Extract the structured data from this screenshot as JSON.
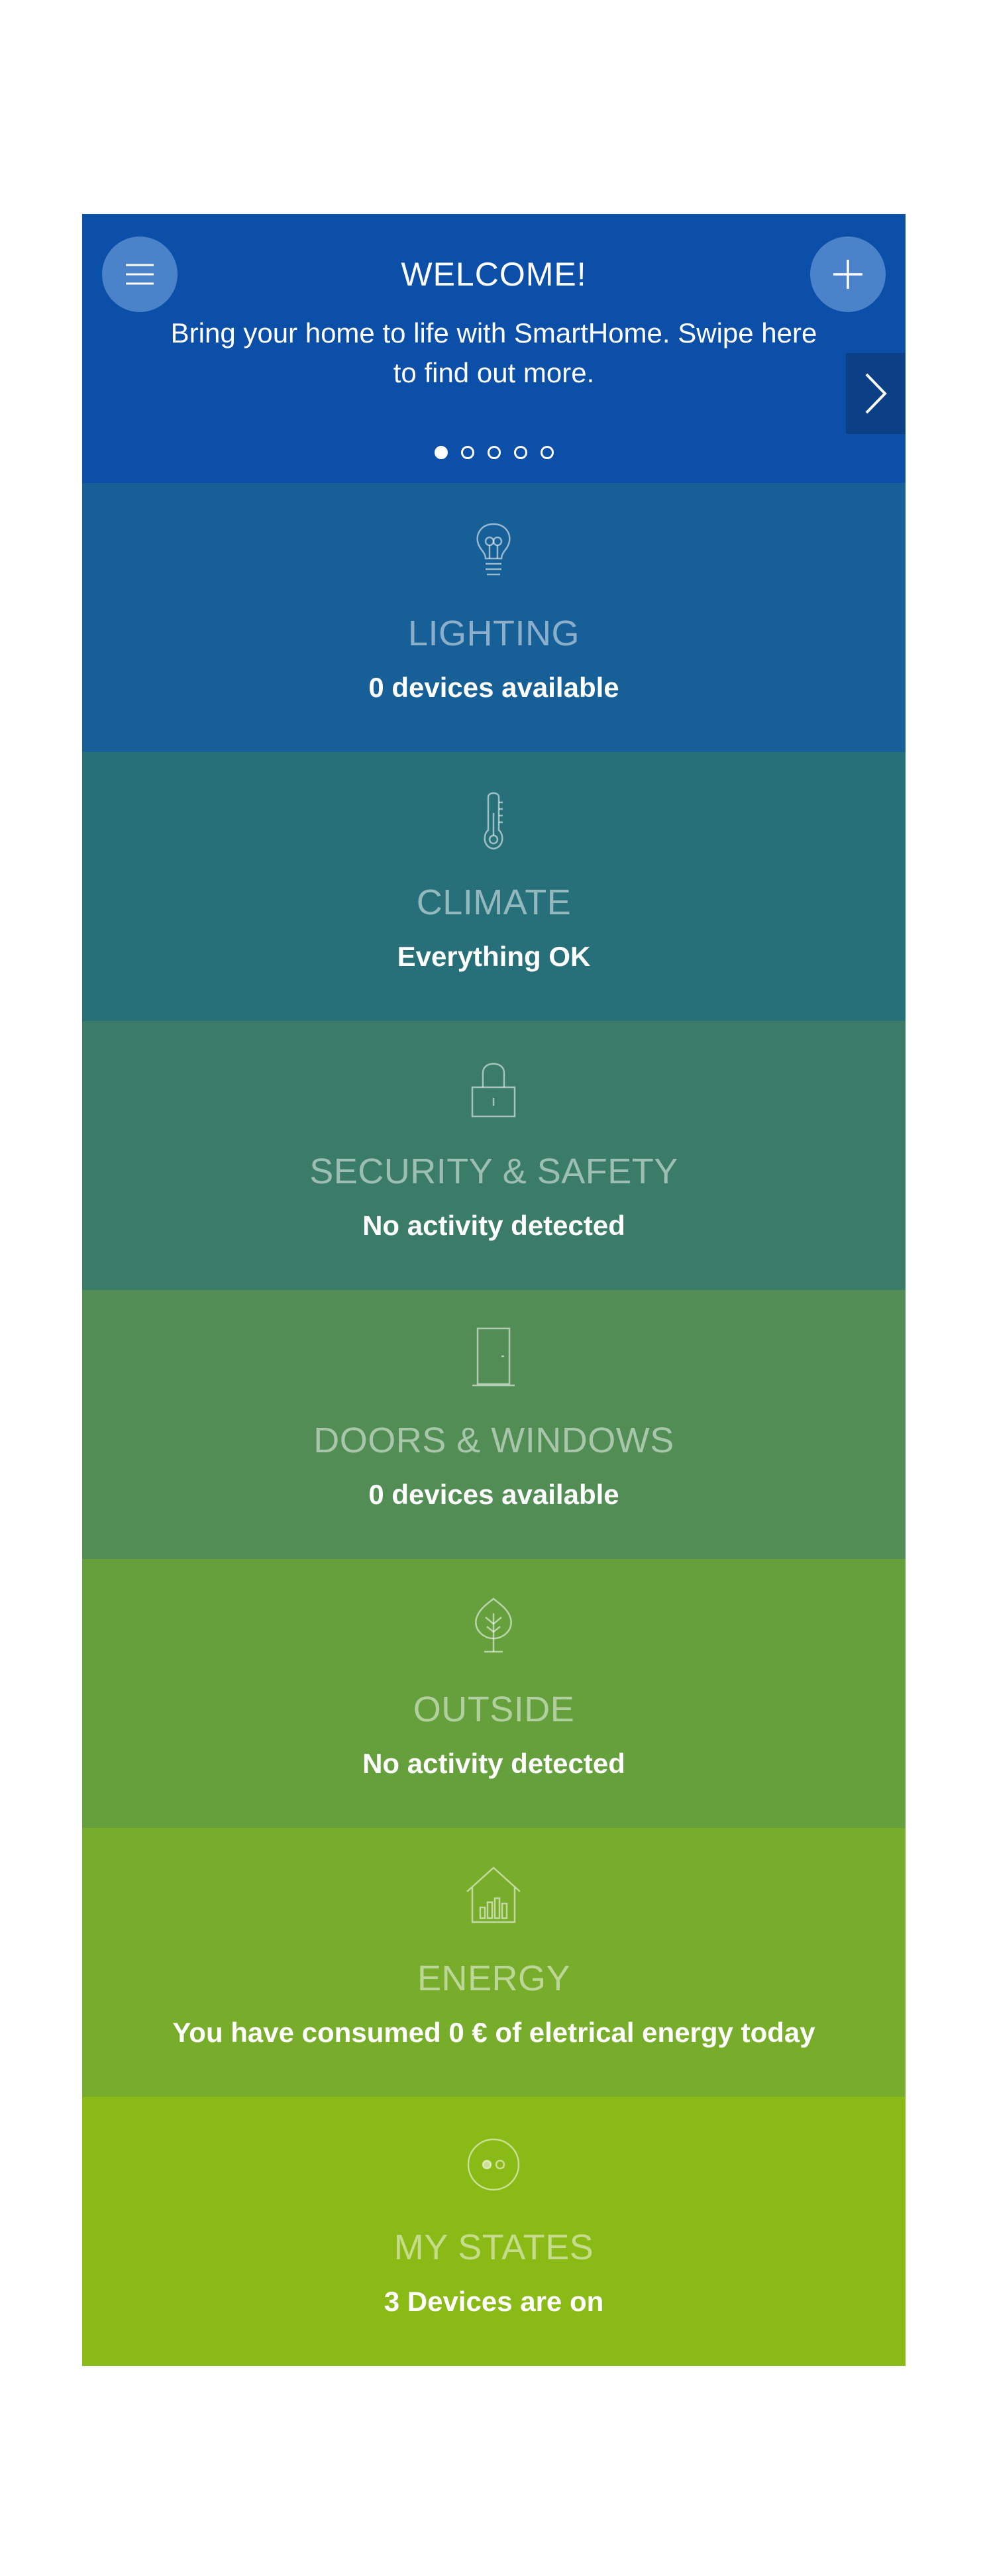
{
  "header": {
    "title": "WELCOME!",
    "text": "Bring your home to life with SmartHome. Swipe here to find out more.",
    "menu_icon": "hamburger-menu-icon",
    "add_icon": "plus-icon",
    "next_icon": "chevron-right-icon",
    "carousel": {
      "pages": 5,
      "active_page": 1
    },
    "background_color": "#0c4fa8"
  },
  "tiles": [
    {
      "title": "LIGHTING",
      "status": "0 devices available",
      "icon": "light-bulb-icon",
      "color": "#175f97"
    },
    {
      "title": "CLIMATE",
      "status": "Everything OK",
      "icon": "thermometer-icon",
      "color": "#27707a"
    },
    {
      "title": "SECURITY & SAFETY",
      "status": "No activity detected",
      "icon": "padlock-icon",
      "color": "#3a7c67"
    },
    {
      "title": "DOORS & WINDOWS",
      "status": "0 devices available",
      "icon": "door-icon",
      "color": "#518d55"
    },
    {
      "title": "OUTSIDE",
      "status": "No activity detected",
      "icon": "tree-icon",
      "color": "#65a03d"
    },
    {
      "title": "ENERGY",
      "status": "You have consumed 0 € of eletrical energy today",
      "icon": "house-energy-icon",
      "color": "#78ad2c"
    },
    {
      "title": "MY STATES",
      "status": "3 Devices are on",
      "icon": "states-toggle-icon",
      "color": "#8aba15"
    }
  ]
}
